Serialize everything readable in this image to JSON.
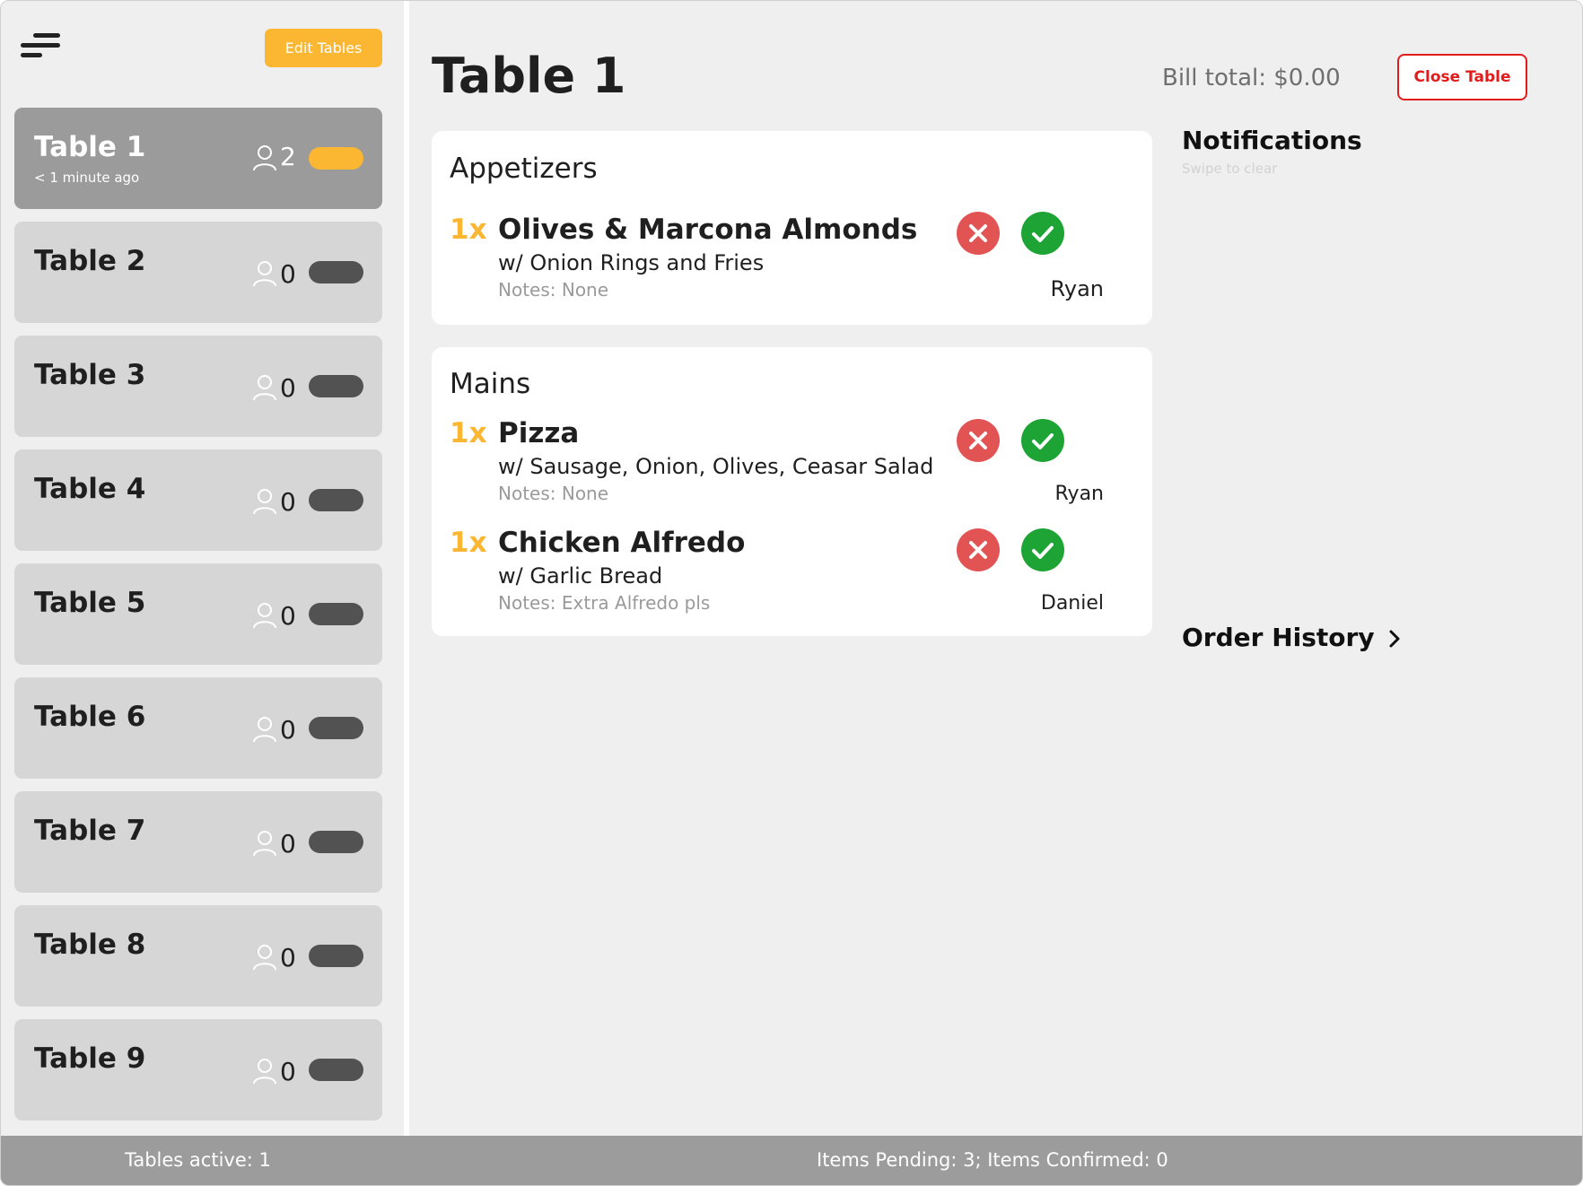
{
  "sidebar": {
    "edit_label": "Edit Tables",
    "tables": [
      {
        "name": "Table 1",
        "subtitle": "< 1 minute ago",
        "guests": "2",
        "status": "active"
      },
      {
        "name": "Table 2",
        "subtitle": "",
        "guests": "0",
        "status": "inactive"
      },
      {
        "name": "Table 3",
        "subtitle": "",
        "guests": "0",
        "status": "inactive"
      },
      {
        "name": "Table 4",
        "subtitle": "",
        "guests": "0",
        "status": "inactive"
      },
      {
        "name": "Table 5",
        "subtitle": "",
        "guests": "0",
        "status": "inactive"
      },
      {
        "name": "Table 6",
        "subtitle": "",
        "guests": "0",
        "status": "inactive"
      },
      {
        "name": "Table 7",
        "subtitle": "",
        "guests": "0",
        "status": "inactive"
      },
      {
        "name": "Table 8",
        "subtitle": "",
        "guests": "0",
        "status": "inactive"
      },
      {
        "name": "Table 9",
        "subtitle": "",
        "guests": "0",
        "status": "inactive"
      }
    ]
  },
  "header": {
    "title": "Table 1",
    "bill_total": "Bill total: $0.00",
    "close_label": "Close Table"
  },
  "order": {
    "sections": [
      {
        "title": "Appetizers",
        "items": [
          {
            "qty": "1x",
            "name": "Olives & Marcona Almonds",
            "mods": "w/ Onion Rings and Fries",
            "notes": "Notes: None",
            "server": "Ryan"
          }
        ]
      },
      {
        "title": "Mains",
        "items": [
          {
            "qty": "1x",
            "name": "Pizza",
            "mods": "w/ Sausage, Onion, Olives, Ceasar Salad",
            "notes": "Notes: None",
            "server": "Ryan"
          },
          {
            "qty": "1x",
            "name": "Chicken Alfredo",
            "mods": "w/ Garlic Bread",
            "notes": "Notes: Extra Alfredo pls",
            "server": "Daniel"
          }
        ]
      }
    ]
  },
  "notifications": {
    "title": "Notifications",
    "hint": "Swipe to clear"
  },
  "order_history_label": "Order History",
  "footer": {
    "tables_active": "Tables active: 1",
    "items_status": "Items Pending: 3; Items Confirmed: 0"
  },
  "colors": {
    "accent": "#fbb731",
    "danger": "#e25353",
    "success": "#1ea435",
    "close_red": "#e21b1b"
  },
  "icons": {
    "menu": "menu-icon",
    "guest": "person-icon",
    "reject": "x-circle-icon",
    "confirm": "check-circle-icon",
    "chevron": "chevron-right-icon"
  }
}
